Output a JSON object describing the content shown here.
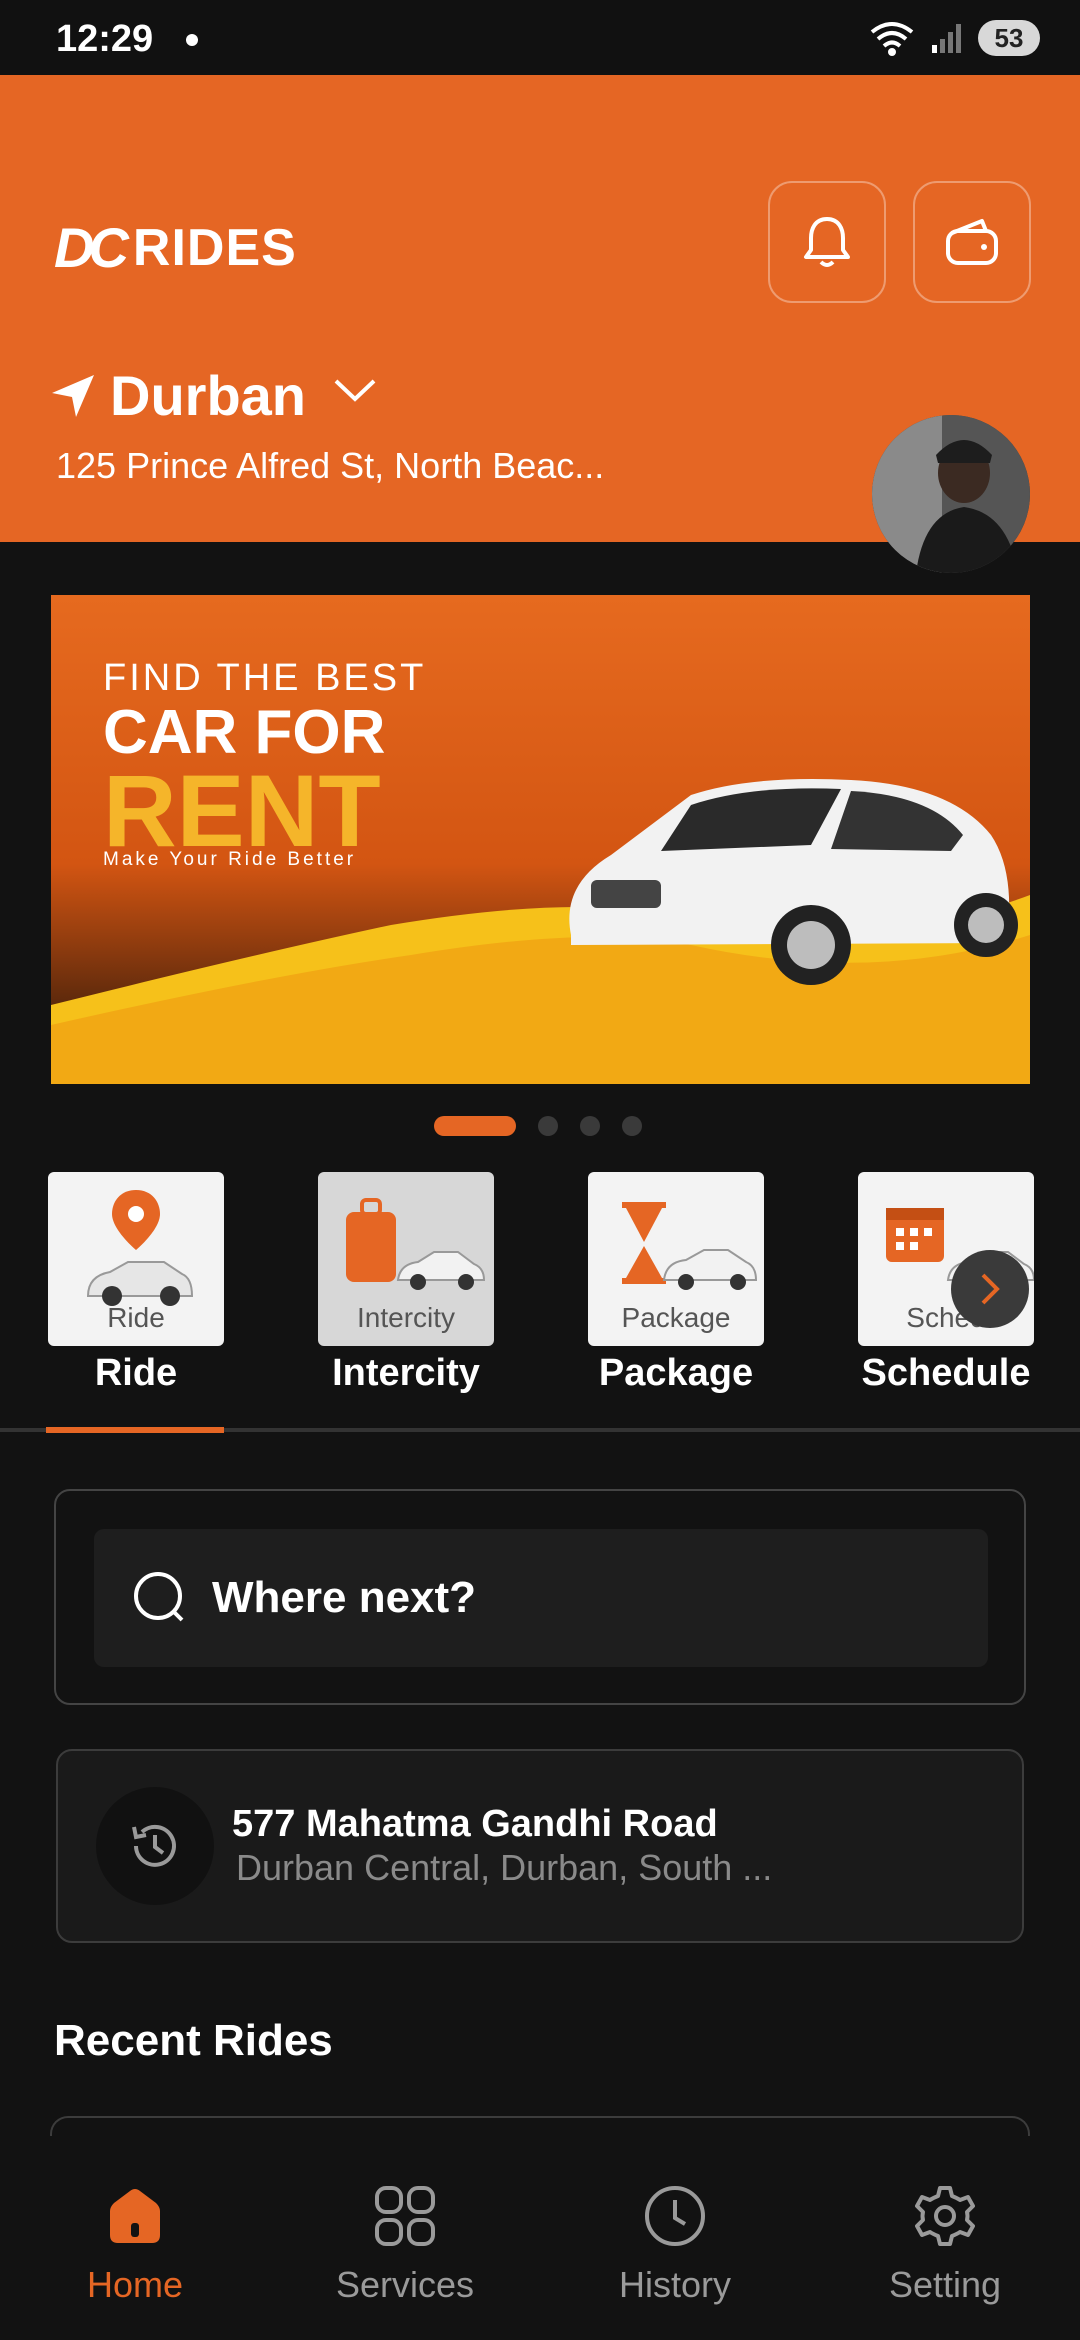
{
  "status_bar": {
    "time": "12:29",
    "battery": "53"
  },
  "header": {
    "logo_text": "RIDES",
    "logo_mark": "DC",
    "city": "Durban",
    "address": "125 Prince Alfred St, North Beac..."
  },
  "banner": {
    "line1": "FIND THE BEST",
    "line2": "CAR FOR",
    "line3": "RENT",
    "line4": "Make Your Ride Better"
  },
  "carousel": {
    "total": 4,
    "active": 1
  },
  "services": [
    {
      "tile_label": "Ride",
      "name": "Ride"
    },
    {
      "tile_label": "Intercity",
      "name": "Intercity"
    },
    {
      "tile_label": "Package",
      "name": "Package"
    },
    {
      "tile_label": "Sched",
      "name": "Schedule"
    }
  ],
  "search": {
    "placeholder": "Where next?"
  },
  "recent_address": {
    "title": "577 Mahatma Gandhi Road",
    "subtitle": "Durban Central, Durban, South ..."
  },
  "recent_rides_title": "Recent Rides",
  "bottom_nav": [
    {
      "label": "Home",
      "icon": "home-icon",
      "active": true
    },
    {
      "label": "Services",
      "icon": "grid-icon",
      "active": false
    },
    {
      "label": "History",
      "icon": "clock-icon",
      "active": false
    },
    {
      "label": "Setting",
      "icon": "gear-icon",
      "active": false
    }
  ],
  "colors": {
    "accent": "#E56624",
    "background": "#121212"
  }
}
